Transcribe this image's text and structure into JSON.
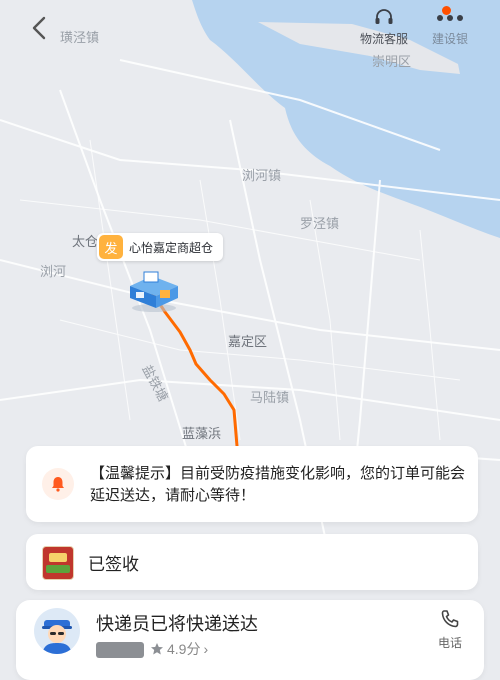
{
  "header": {
    "customer_service_label": "物流客服",
    "settings_label": "建设银",
    "notification_dot": true
  },
  "map": {
    "place_labels": [
      "璜泾镇",
      "崇明区",
      "浏河镇",
      "罗泾镇",
      "太仓",
      "浏河",
      "嘉定区",
      "盐铁塘",
      "马陆镇",
      "蓝藻浜"
    ],
    "origin_marker": {
      "badge": "发",
      "name": "心怡嘉定商超仓"
    },
    "colors": {
      "land": "#e9ebef",
      "water": "#b6d3ef",
      "route": "#ff6a00",
      "accent": "#ff5000"
    }
  },
  "notice": {
    "text": "【温馨提示】目前受防疫措施变化影响，您的订单可能会延迟送达，请耐心等待！",
    "icon": "bell-icon"
  },
  "status": {
    "label": "已签收"
  },
  "courier": {
    "title": "快递员已将快递送达",
    "rating": "4.9分",
    "phone_label": "电话"
  }
}
